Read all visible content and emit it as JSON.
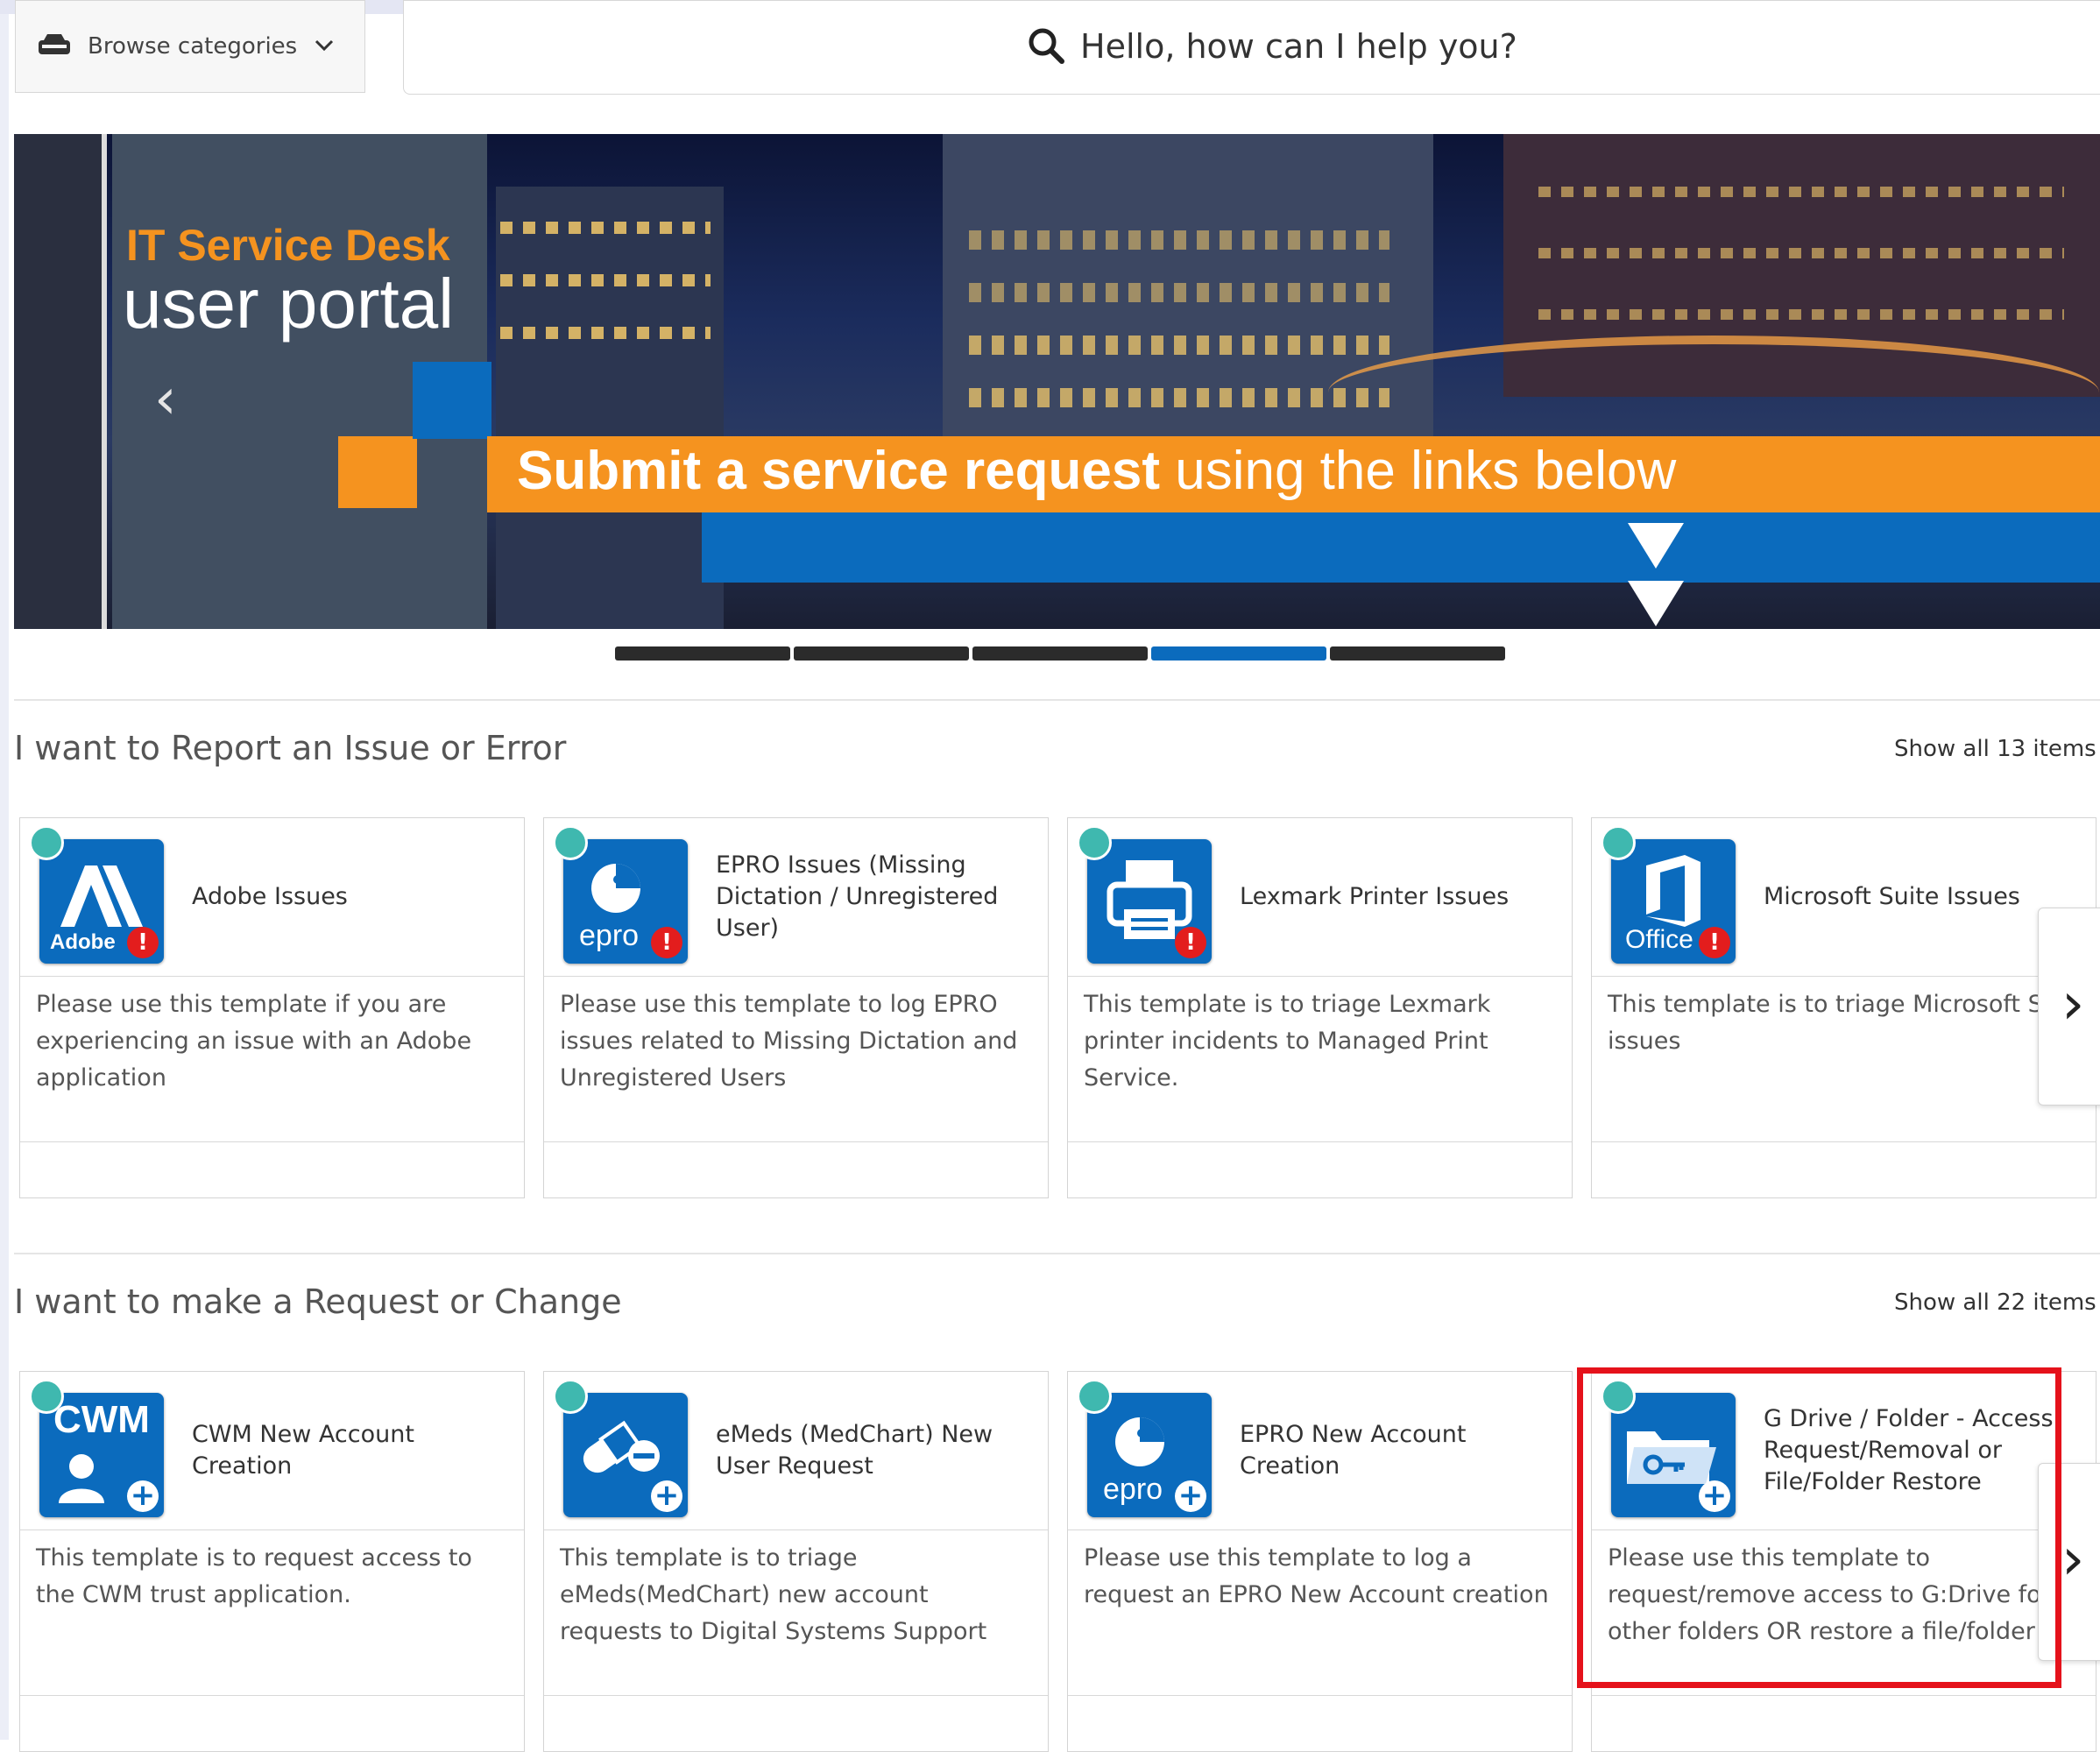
{
  "header": {
    "browse_label": "Browse categories",
    "search_placeholder": "Hello, how can I help you?"
  },
  "banner": {
    "title_line1": "IT Service Desk",
    "title_line2": "user portal",
    "slogan_bold": "Submit a service request",
    "slogan_rest": " using the links below",
    "slide_count": 5,
    "active_slide": 4
  },
  "sections": [
    {
      "title": "I want to Report an Issue or Error",
      "show_all": "Show all 13 items ›",
      "cards": [
        {
          "title": "Adobe Issues",
          "desc": "Please use this template if you are experiencing an issue with an Adobe application",
          "icon": "adobe-icon",
          "icon_label": "Adobe"
        },
        {
          "title": "EPRO Issues (Missing Dictation / Unregistered User)",
          "desc": "Please use this template to log EPRO issues related to Missing Dictation and Unregistered Users",
          "icon": "epro-icon",
          "icon_label": "epro"
        },
        {
          "title": "Lexmark Printer Issues",
          "desc": "This template is to triage Lexmark printer incidents to Managed Print Service.",
          "icon": "printer-icon",
          "icon_label": ""
        },
        {
          "title": "Microsoft Suite Issues",
          "desc": "This template is to triage Microsoft Sui issues",
          "icon": "office-icon",
          "icon_label": "Office"
        }
      ]
    },
    {
      "title": "I want to make a Request or Change",
      "show_all": "Show all 22 items ›",
      "cards": [
        {
          "title": "CWM New Account Creation",
          "desc": "This template is to request access to the CWM trust application.",
          "icon": "cwm-user-icon",
          "icon_label": "CWM"
        },
        {
          "title": "eMeds (MedChart) New User Request",
          "desc": "This template is to triage eMeds(MedChart) new account requests to Digital Systems Support",
          "icon": "pill-icon",
          "icon_label": ""
        },
        {
          "title": "EPRO New Account Creation",
          "desc": "Please use this template to log a request an EPRO New Account creation",
          "icon": "epro-icon",
          "icon_label": "epro"
        },
        {
          "title": "G Drive / Folder - Access Request/Removal or File/Folder Restore",
          "desc": "Please use this template to request/remove access to G:Drive fold / other folders OR restore a file/folder",
          "icon": "folder-key-icon",
          "icon_label": ""
        }
      ]
    }
  ],
  "colors": {
    "brand_blue": "#0b6bbd",
    "brand_orange": "#f5931f",
    "alert_red": "#e31d1d",
    "award_teal": "#3fb8af",
    "highlight_red": "#e5121b"
  }
}
